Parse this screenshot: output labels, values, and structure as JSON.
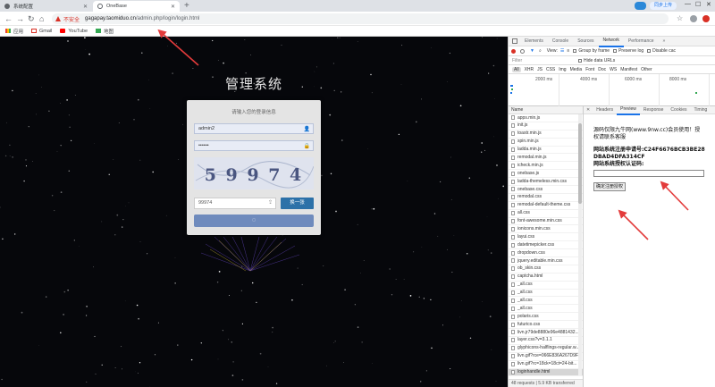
{
  "tabs": [
    {
      "title": "系统配置",
      "active": false
    },
    {
      "title": "OneBase",
      "active": true
    }
  ],
  "toolbar": {
    "insecure_label": "不安全",
    "url_host": "gagapay.taomiduo.cn",
    "url_path": "/admin.php/login/login.html",
    "account_chip": "同步上传"
  },
  "bookmarks": [
    {
      "label": "应用",
      "icon": "apps-icon"
    },
    {
      "label": "Gmail",
      "icon": "gmail-icon"
    },
    {
      "label": "YouTube",
      "icon": "youtube-icon"
    },
    {
      "label": "地图",
      "icon": "maps-icon"
    }
  ],
  "login": {
    "system_title": "管理系统",
    "subtitle": "请输入您的登录信息",
    "username": "admin2",
    "password": "••••••",
    "captcha_text": "5 9 9 7 4",
    "captcha_input": "99974",
    "refresh_label": "换一张"
  },
  "devtools": {
    "tabs": [
      "Elements",
      "Console",
      "Sources",
      "Network",
      "Performance"
    ],
    "selected_tab": "Network",
    "view_label": "View:",
    "group_by_frame": "Group by frame",
    "preserve_log": "Preserve log",
    "disable_cache": "Disable cac",
    "filter_placeholder": "Filter",
    "hide_data_urls": "Hide data URLs",
    "types": [
      "All",
      "XHR",
      "JS",
      "CSS",
      "Img",
      "Media",
      "Font",
      "Doc",
      "WS",
      "Manifest",
      "Other"
    ],
    "timeline_labels": [
      "2000 ms",
      "4000 ms",
      "6000 ms",
      "8000 ms"
    ],
    "list_header": "Name",
    "requests": [
      "apps.min.js",
      "init.js",
      "toastr.min.js",
      "spin.min.js",
      "ladda.min.js",
      "remodal.min.js",
      "icheck.min.js",
      "onebase.js",
      "ladda-themeless.min.css",
      "onebase.css",
      "remodal.css",
      "remodal-default-theme.css",
      "all.css",
      "font-awesome.min.css",
      "ionicons.min.css",
      "layui.css",
      "datetimepicker.css",
      "dropdown.css",
      "jquery.editable.min.css",
      "ob_skin.css",
      "captcha.html",
      "_all.css",
      "_all.css",
      "_all.css",
      "_all.css",
      "polaris.css",
      "futurico.css",
      "livn.jr79de8880e96e4881432...",
      "layer.css?v=3.1.1",
      "glyphicons-halflings-regular.w...",
      "livn.gif?rce=066E836A267D9F...",
      "livn.gif?rc=18ck=18ct=24-bit...",
      "loginhandle.html"
    ],
    "selected_request": "loginhandle.html",
    "footer": "48 requests  |  5.9 KB transferred",
    "detail_tabs": [
      "Headers",
      "Preview",
      "Response",
      "Cookies",
      "Timing"
    ],
    "selected_detail_tab": "Preview",
    "preview": {
      "line1": "源码仅限九牛网(www.9nw.cc)会员使用！授权请联系客服",
      "line2": "网站系统注册申请号:C24F6676BCB3BE28DBAD4DFA314CF",
      "line3": "网站系统授权认证码:",
      "button": "确定注册授权"
    }
  },
  "colors": {
    "accent": "#1a73e8",
    "warning": "#d93025",
    "annotation_arrow": "#e33b3b",
    "login_button": "#6f8bbd",
    "refresh_button": "#2c71a8"
  }
}
